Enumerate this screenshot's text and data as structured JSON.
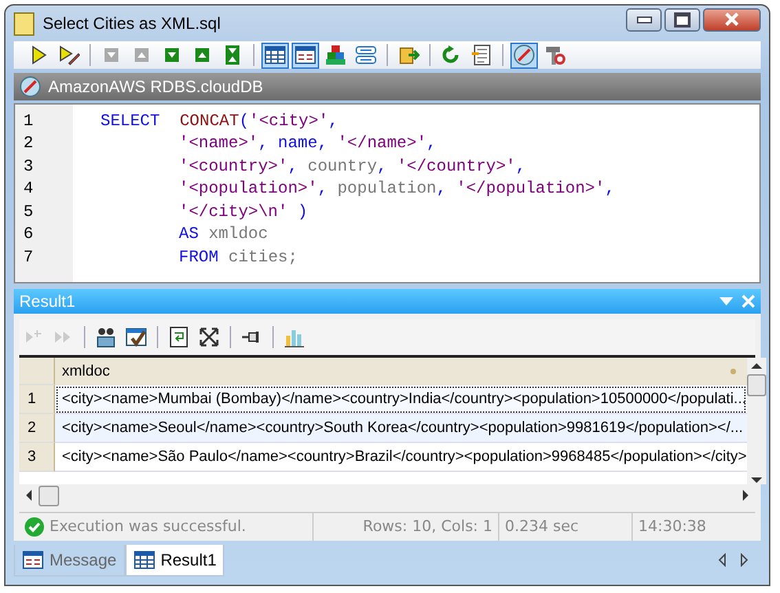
{
  "window": {
    "title": "Select Cities as XML.sql"
  },
  "toolbar": [
    {
      "kind": "run",
      "pressed": false,
      "group_start": false
    },
    {
      "kind": "run-edit",
      "pressed": false,
      "group_start": false
    },
    {
      "kind": "nav-down",
      "pressed": false,
      "group_start": true
    },
    {
      "kind": "nav-up",
      "pressed": false,
      "group_start": false
    },
    {
      "kind": "green-down",
      "pressed": false,
      "group_start": false
    },
    {
      "kind": "green-up",
      "pressed": false,
      "group_start": false
    },
    {
      "kind": "green-both",
      "pressed": false,
      "group_start": false
    },
    {
      "kind": "grid",
      "pressed": true,
      "group_start": true
    },
    {
      "kind": "form",
      "pressed": true,
      "group_start": false
    },
    {
      "kind": "blocks",
      "pressed": false,
      "group_start": false
    },
    {
      "kind": "list",
      "pressed": false,
      "group_start": false
    },
    {
      "kind": "export",
      "pressed": false,
      "group_start": true
    },
    {
      "kind": "refresh",
      "pressed": false,
      "group_start": true
    },
    {
      "kind": "doc",
      "pressed": false,
      "group_start": false
    },
    {
      "kind": "compass",
      "pressed": true,
      "group_start": true
    },
    {
      "kind": "tools",
      "pressed": false,
      "group_start": false
    }
  ],
  "connection": {
    "name": "AmazonAWS RDBS.cloudDB"
  },
  "editor": {
    "lines": [
      {
        "number": "1",
        "indented": false,
        "tokens": [
          {
            "kind": "keyword",
            "text": "SELECT  "
          },
          {
            "kind": "function",
            "text": "CONCAT"
          },
          {
            "kind": "punct",
            "text": "("
          },
          {
            "kind": "string",
            "text": "'<city>'"
          },
          {
            "kind": "punct",
            "text": ","
          }
        ]
      },
      {
        "number": "2",
        "indented": true,
        "tokens": [
          {
            "kind": "string",
            "text": "'<name>'"
          },
          {
            "kind": "punct",
            "text": ", name, "
          },
          {
            "kind": "string",
            "text": "'</name>'"
          },
          {
            "kind": "punct",
            "text": ","
          }
        ]
      },
      {
        "number": "3",
        "indented": true,
        "tokens": [
          {
            "kind": "string",
            "text": "'<country>'"
          },
          {
            "kind": "punct",
            "text": ", "
          },
          {
            "kind": "ident",
            "text": "country"
          },
          {
            "kind": "punct",
            "text": ", "
          },
          {
            "kind": "string",
            "text": "'</country>'"
          },
          {
            "kind": "punct",
            "text": ","
          }
        ]
      },
      {
        "number": "4",
        "indented": true,
        "tokens": [
          {
            "kind": "string",
            "text": "'<population>'"
          },
          {
            "kind": "punct",
            "text": ", "
          },
          {
            "kind": "ident",
            "text": "population"
          },
          {
            "kind": "punct",
            "text": ", "
          },
          {
            "kind": "string",
            "text": "'</population>'"
          },
          {
            "kind": "punct",
            "text": ","
          }
        ]
      },
      {
        "number": "5",
        "indented": true,
        "tokens": [
          {
            "kind": "string",
            "text": "'</city>\\n'"
          },
          {
            "kind": "punct",
            "text": " )"
          }
        ]
      },
      {
        "number": "6",
        "indented": true,
        "tokens": [
          {
            "kind": "keyword",
            "text": "AS"
          },
          {
            "kind": "ident",
            "text": " xmldoc"
          }
        ]
      },
      {
        "number": "7",
        "indented": true,
        "tokens": [
          {
            "kind": "keyword",
            "text": "FROM"
          },
          {
            "kind": "ident",
            "text": " cities;"
          }
        ]
      }
    ]
  },
  "result": {
    "title": "Result1",
    "toolbar": [
      {
        "kind": "append",
        "disabled": true,
        "group_start": false
      },
      {
        "kind": "forward",
        "disabled": true,
        "group_start": false
      },
      {
        "kind": "people",
        "disabled": false,
        "group_start": true
      },
      {
        "kind": "check",
        "disabled": false,
        "group_start": false
      },
      {
        "kind": "wrap",
        "disabled": false,
        "group_start": true
      },
      {
        "kind": "expand",
        "disabled": false,
        "group_start": false
      },
      {
        "kind": "pin",
        "disabled": false,
        "group_start": true
      },
      {
        "kind": "chart",
        "disabled": false,
        "group_start": true
      }
    ],
    "columns": [
      "xmldoc"
    ],
    "rows": [
      {
        "number": "1",
        "selected": true,
        "cells": [
          "<city><name>Mumbai (Bombay)</name><country>India</country><population>10500000</populati..."
        ]
      },
      {
        "number": "2",
        "selected": false,
        "cells": [
          "<city><name>Seoul</name><country>South Korea</country><population>9981619</population></..."
        ]
      },
      {
        "number": "3",
        "selected": false,
        "cells": [
          "<city><name>São Paulo</name><country>Brazil</country><population>9968485</population></city>"
        ]
      }
    ],
    "status": {
      "message": "Execution was successful.",
      "rows": "Rows: 10, Cols: 1",
      "time": "0.234 sec",
      "clock": "14:30:38"
    }
  },
  "bottom_tabs": [
    {
      "label": "Message",
      "kind": "form",
      "selected": false
    },
    {
      "label": "Result1",
      "kind": "grid",
      "selected": true
    }
  ]
}
